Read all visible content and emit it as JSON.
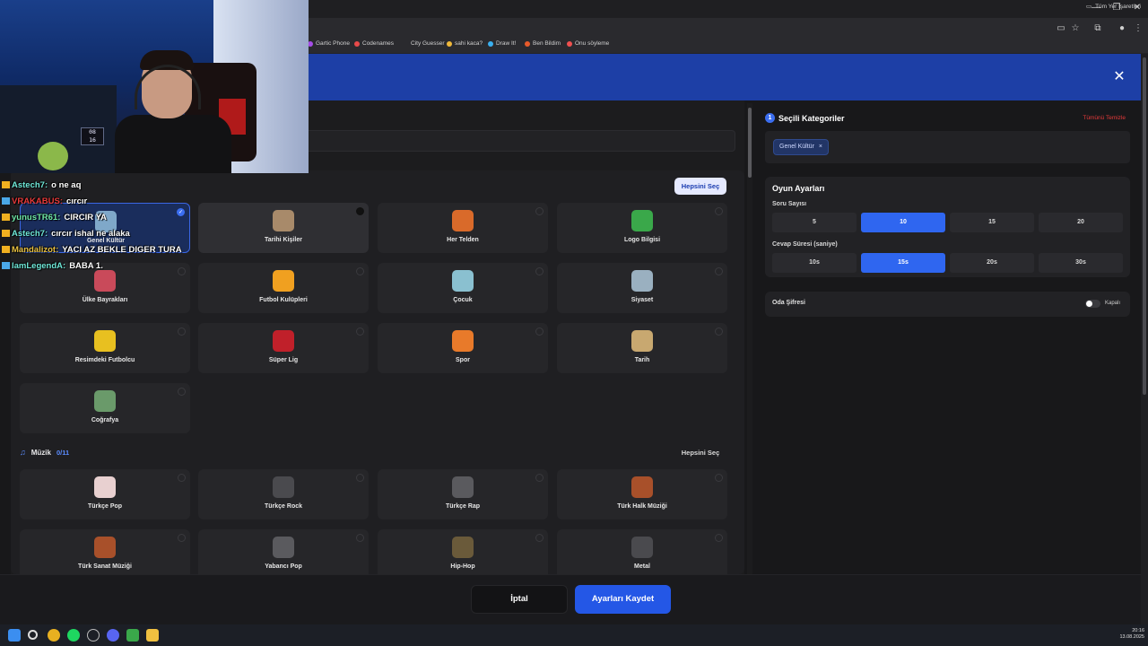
{
  "window": {
    "minimize": "—",
    "restore": "❐",
    "close": "✕"
  },
  "bookmarks": [
    {
      "label": "Gartic Phone",
      "color": "#a64de8"
    },
    {
      "label": "Codenames",
      "color": "#e84a4a"
    },
    {
      "label": "City Guesser",
      "color": "#2a2a2e"
    },
    {
      "label": "sahi kaca?",
      "color": "#f0b93a"
    },
    {
      "label": "Draw It!",
      "color": "#3ab0f0"
    },
    {
      "label": "Ben Bildim",
      "color": "#e85a2a"
    },
    {
      "label": "Onu söyleme",
      "color": "#f05050"
    }
  ],
  "all_bookmarks": "Tüm Yer İşaretleri",
  "modal": {
    "close": "✕"
  },
  "categories": {
    "general": {
      "select_all": "Hepsini Seç",
      "tiles": [
        {
          "label": "Genel Kültür",
          "selected": true,
          "icon_color": "#7fa8c9"
        },
        {
          "label": "Tarihi Kişiler",
          "icon_color": "#a88a6a",
          "hover": true
        },
        {
          "label": "Her Telden",
          "icon_color": "#d96a2a"
        },
        {
          "label": "Logo Bilgisi",
          "icon_color": "#3aa84a"
        },
        {
          "label": "Ülke Bayrakları",
          "icon_color": "#c94a5a"
        },
        {
          "label": "Futbol Kulüpleri",
          "icon_color": "#f0a020"
        },
        {
          "label": "Çocuk",
          "icon_color": "#8ac0d0"
        },
        {
          "label": "Siyaset",
          "icon_color": "#9ab0c0"
        },
        {
          "label": "Resimdeki Futbolcu",
          "icon_color": "#e8c020"
        },
        {
          "label": "Süper Lig",
          "icon_color": "#c0202a"
        },
        {
          "label": "Spor",
          "icon_color": "#e87a2a"
        },
        {
          "label": "Tarih",
          "icon_color": "#c8a870"
        },
        {
          "label": "Coğrafya",
          "icon_color": "#6a9a6a"
        }
      ]
    },
    "music": {
      "title": "Müzik",
      "count": "0/11",
      "select_all": "Hepsini Seç",
      "tiles": [
        {
          "label": "Türkçe Pop",
          "icon_color": "#e8d0d0"
        },
        {
          "label": "Türkçe Rock",
          "icon_color": "#4a4a4e"
        },
        {
          "label": "Türkçe Rap",
          "icon_color": "#5a5a5e"
        },
        {
          "label": "Türk Halk Müziği",
          "icon_color": "#a8502a"
        },
        {
          "label": "Türk Sanat Müziği",
          "icon_color": "#a8502a"
        },
        {
          "label": "Yabancı Pop",
          "icon_color": "#5a5a5e"
        },
        {
          "label": "Hip-Hop",
          "icon_color": "#6a5a3a"
        },
        {
          "label": "Metal",
          "icon_color": "#4a4a4e"
        }
      ]
    }
  },
  "selected": {
    "step": "1",
    "title": "Seçili Kategoriler",
    "clear_all": "Tümünü Temizle",
    "chips": [
      {
        "label": "Genel Kültür",
        "remove": "×"
      }
    ]
  },
  "settings": {
    "title": "Oyun Ayarları",
    "question_count": {
      "label": "Soru Sayısı",
      "options": [
        "5",
        "10",
        "15",
        "20"
      ],
      "selected": "10"
    },
    "answer_time": {
      "label": "Cevap Süresi (saniye)",
      "options": [
        "10s",
        "15s",
        "20s",
        "30s"
      ],
      "selected": "15s"
    }
  },
  "room_password": {
    "label": "Oda Şifresi",
    "state": "Kapalı"
  },
  "footer": {
    "cancel": "İptal",
    "save": "Ayarları Kaydet"
  },
  "taskbar": {
    "time": "20:16",
    "date": "13.08.2025"
  },
  "webcam": {
    "clock": "08\n16"
  },
  "chat": [
    {
      "user": "Astech7:",
      "text": "o ne aq",
      "color": "#6fe8d8"
    },
    {
      "user": "VRAKABUS:",
      "text": "cırcır",
      "color": "#e83a3a"
    },
    {
      "user": "yunusTR61:",
      "text": "CIRCIR YA",
      "color": "#6fe8a8"
    },
    {
      "user": "Astech7:",
      "text": "cırcır ishal ne alaka",
      "color": "#6fe8d8"
    },
    {
      "user": "Mandalizot:",
      "text": "YACI AZ BEKLE DIGER TURA",
      "color": "#e8c040"
    },
    {
      "user": "lamLegendA:",
      "text": "BABA 1.",
      "color": "#6fe8d8"
    }
  ],
  "colors": {
    "accent": "#2f66f0",
    "banner": "#1d3fa6",
    "danger": "#e43a3a"
  }
}
